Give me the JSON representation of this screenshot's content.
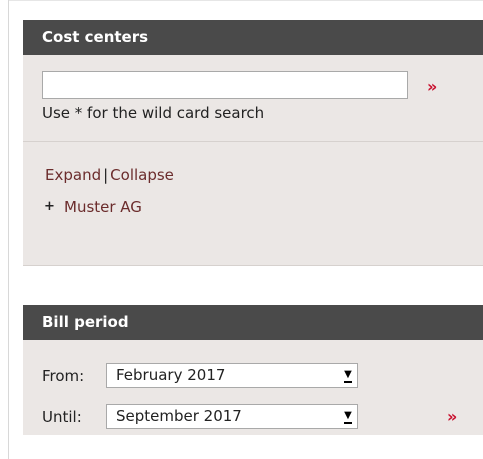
{
  "cost_centers": {
    "title": "Cost centers",
    "search": {
      "value": "",
      "placeholder": ""
    },
    "go_label": "»",
    "hint": "Use * for the wild card search",
    "expand_label": "Expand",
    "separator": "|",
    "collapse_label": "Collapse",
    "tree": [
      {
        "toggle": "+",
        "label": "Muster AG"
      }
    ]
  },
  "bill_period": {
    "title": "Bill period",
    "from_label": "From:",
    "from_value": "February 2017",
    "until_label": "Until:",
    "until_value": "September 2017",
    "go_label": "»"
  },
  "colors": {
    "header_bg": "#4a4a4a",
    "panel_bg": "#ebe7e5",
    "accent": "#c8102e",
    "link": "#6b2c2c"
  },
  "icons": {
    "go": "double-chevron-right-icon",
    "expand_node": "plus-icon",
    "dropdown": "dropdown-arrow-icon"
  }
}
